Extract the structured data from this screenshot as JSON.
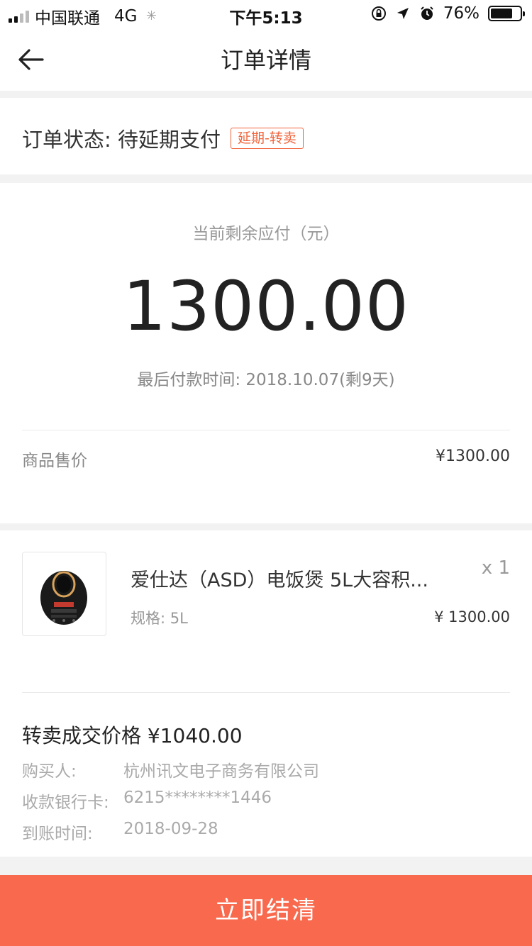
{
  "status_bar": {
    "carrier": "中国联通",
    "network": "4G",
    "time": "下午5:13",
    "battery": "76%",
    "battery_level": 0.76
  },
  "nav": {
    "title": "订单详情",
    "back_icon": "arrow-left-icon"
  },
  "order": {
    "status_text": "订单状态: 待延期支付",
    "status_tag": "延期-转卖"
  },
  "payment": {
    "label": "当前剩余应付（元）",
    "amount": "1300.00",
    "deadline": "最后付款时间: 2018.10.07(剩9天)",
    "price_label": "商品售价",
    "price_value": "¥1300.00"
  },
  "product": {
    "name": "爱仕达（ASD）电饭煲 5L大容积...",
    "qty": "x 1",
    "spec": "规格: 5L",
    "price": "¥ 1300.00"
  },
  "resale": {
    "title": "转卖成交价格  ¥1040.00",
    "rows": [
      {
        "label": "购买人:",
        "value": "杭州讯文电子商务有限公司"
      },
      {
        "label": "收款银行卡:",
        "value": "6215********1446"
      },
      {
        "label": "到账时间:",
        "value": "2018-09-28"
      }
    ]
  },
  "actions": {
    "settle_label": "立即结清",
    "accent_color": "#f8694d"
  }
}
